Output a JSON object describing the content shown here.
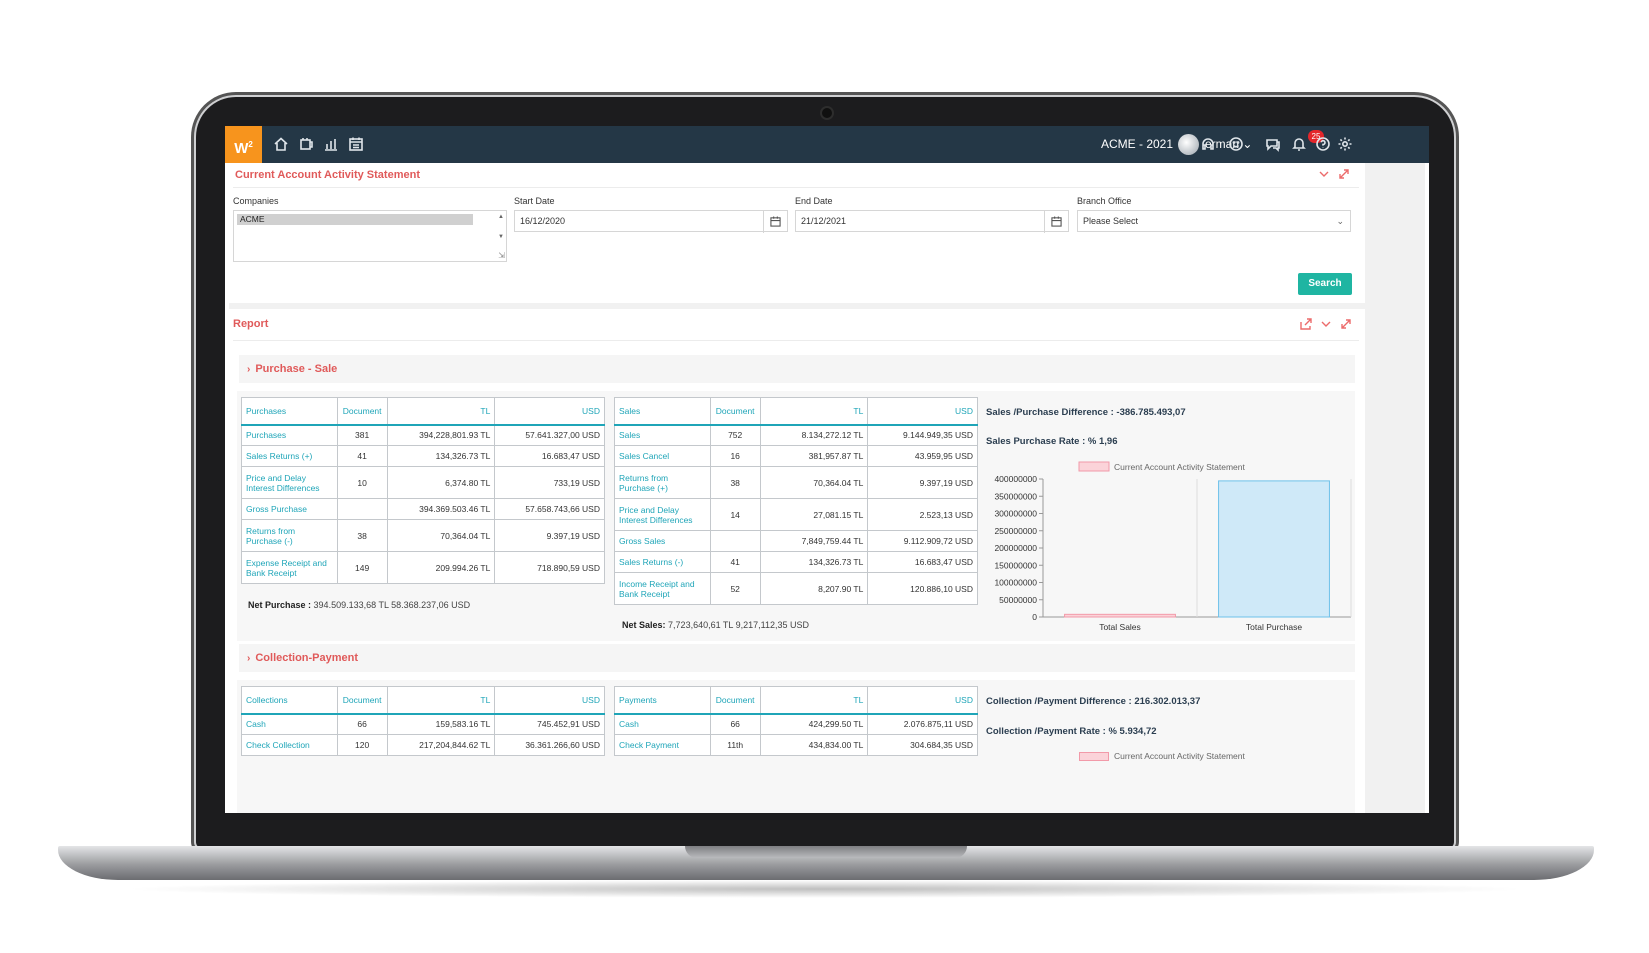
{
  "topbar": {
    "logo": "W",
    "logo_sup": "2",
    "company": "ACME - 2021",
    "user": "erman",
    "notifications": "25"
  },
  "filter_panel": {
    "title": "Current Account Activity Statement",
    "companies_label": "Companies",
    "companies_selected": "ACME",
    "start_date_label": "Start Date",
    "start_date": "16/12/2020",
    "end_date_label": "End Date",
    "end_date": "21/12/2021",
    "branch_label": "Branch Office",
    "branch_placeholder": "Please Select",
    "search_label": "Search"
  },
  "report": {
    "title": "Report",
    "purchase_sale_title": "Purchase - Sale",
    "collection_payment_title": "Collection-Payment"
  },
  "purchases": {
    "headers": [
      "Purchases",
      "Document",
      "TL",
      "USD"
    ],
    "rows": [
      {
        "name": "Purchases",
        "doc": "381",
        "tl": "394,228,801.93 TL",
        "usd": "57.641.327,00 USD"
      },
      {
        "name": "Sales Returns (+)",
        "doc": "41",
        "tl": "134,326.73 TL",
        "usd": "16.683,47 USD"
      },
      {
        "name": "Price and Delay Interest Differences",
        "doc": "10",
        "tl": "6,374.80 TL",
        "usd": "733,19 USD"
      },
      {
        "name": "Gross Purchase",
        "doc": "",
        "tl": "394.369.503.46 TL",
        "usd": "57.658.743,66 USD"
      },
      {
        "name": "Returns from Purchase (-)",
        "doc": "38",
        "tl": "70,364.04 TL",
        "usd": "9.397,19 USD"
      },
      {
        "name": "Expense Receipt and Bank Receipt",
        "doc": "149",
        "tl": "209.994.26 TL",
        "usd": "718.890,59 USD"
      }
    ],
    "net_label": "Net Purchase :",
    "net_value": "394.509.133,68 TL   58.368.237,06 USD"
  },
  "sales": {
    "headers": [
      "Sales",
      "Document",
      "TL",
      "USD"
    ],
    "rows": [
      {
        "name": "Sales",
        "doc": "752",
        "tl": "8.134,272.12 TL",
        "usd": "9.144.949,35 USD"
      },
      {
        "name": "Sales Cancel",
        "doc": "16",
        "tl": "381,957.87 TL",
        "usd": "43.959,95 USD"
      },
      {
        "name": "Returns from Purchase (+)",
        "doc": "38",
        "tl": "70,364.04 TL",
        "usd": "9.397,19 USD"
      },
      {
        "name": "Price and Delay Interest Differences",
        "doc": "14",
        "tl": "27,081.15 TL",
        "usd": "2.523,13 USD"
      },
      {
        "name": "Gross Sales",
        "doc": "",
        "tl": "7,849,759.44 TL",
        "usd": "9.112.909,72 USD"
      },
      {
        "name": "Sales Returns (-)",
        "doc": "41",
        "tl": "134,326.73 TL",
        "usd": "16.683,47 USD"
      },
      {
        "name": "Income Receipt and Bank Receipt",
        "doc": "52",
        "tl": "8,207.90 TL",
        "usd": "120.886,10 USD"
      }
    ],
    "net_label": "Net Sales:",
    "net_value": "7,723,640,61 TL 9,217,112,35 USD"
  },
  "purchase_summary": {
    "difference": "Sales /Purchase Difference : -386.785.493,07",
    "rate": "Sales Purchase Rate : % 1,96"
  },
  "collections": {
    "headers": [
      "Collections",
      "Document",
      "TL",
      "USD"
    ],
    "rows": [
      {
        "name": "Cash",
        "doc": "66",
        "tl": "159,583.16 TL",
        "usd": "745.452,91 USD"
      },
      {
        "name": "Check Collection",
        "doc": "120",
        "tl": "217,204,844.62 TL",
        "usd": "36.361.266,60 USD"
      }
    ]
  },
  "payments": {
    "headers": [
      "Payments",
      "Document",
      "TL",
      "USD"
    ],
    "rows": [
      {
        "name": "Cash",
        "doc": "66",
        "tl": "424,299.50 TL",
        "usd": "2.076.875,11 USD"
      },
      {
        "name": "Check Payment",
        "doc": "11th",
        "tl": "434,834.00 TL",
        "usd": "304.684,35 USD"
      }
    ]
  },
  "collection_summary": {
    "difference": "Collection /Payment Difference : 216.302.013,37",
    "rate": "Collection /Payment Rate : % 5.934,72",
    "legend": "Current Account Activity Statement"
  },
  "chart_data": {
    "type": "bar",
    "legend": "Current Account Activity Statement",
    "categories": [
      "Total Sales",
      "Total Purchase"
    ],
    "values": [
      7723640,
      394509133
    ],
    "ylim": [
      0,
      400000000
    ],
    "yticks": [
      "0",
      "50000000",
      "100000000",
      "150000000",
      "200000000",
      "250000000",
      "300000000",
      "350000000",
      "400000000"
    ],
    "colors": {
      "series": "#cfe9f8",
      "series_border": "#6ec1ea",
      "legend_swatch": "#fbd3d9",
      "legend_border": "#f29aa9"
    }
  }
}
